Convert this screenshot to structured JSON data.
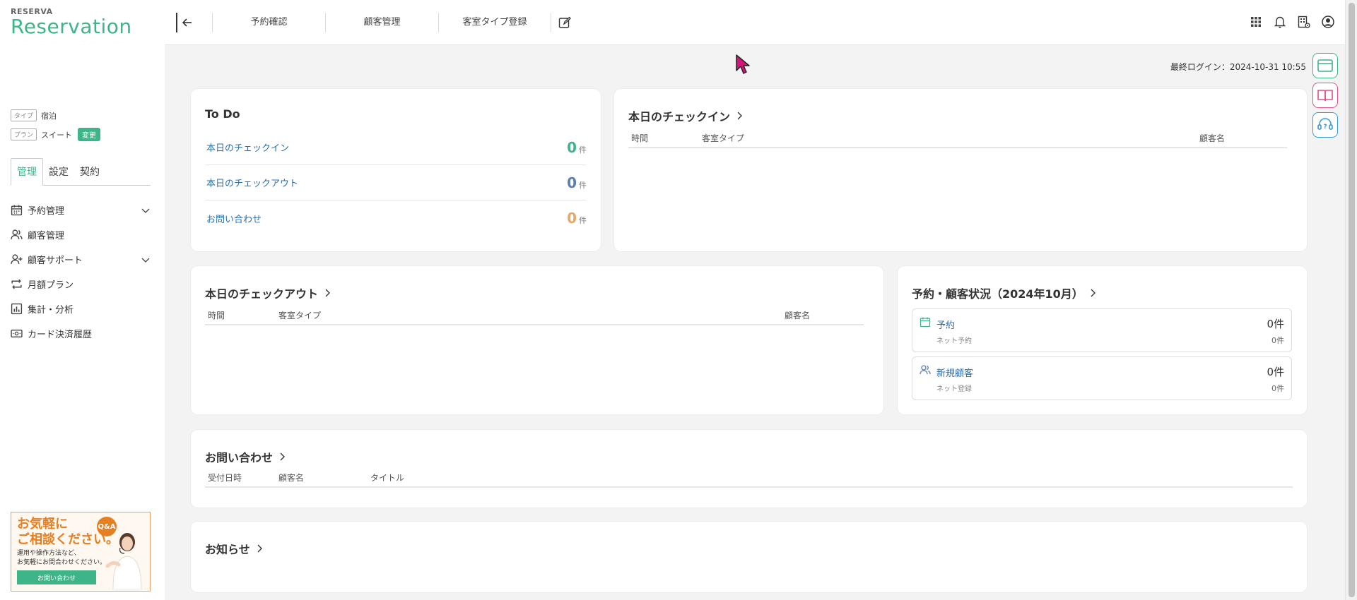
{
  "brand": {
    "small": "RESERVA",
    "big": "Reservation"
  },
  "account": {
    "type_tag": "タイプ",
    "type_value": "宿泊",
    "plan_tag": "プラン",
    "plan_value": "スイート",
    "plan_change": "変更"
  },
  "side_tabs": [
    "管理",
    "設定",
    "契約"
  ],
  "side_menu": [
    {
      "label": "予約管理",
      "icon": "calendar-icon",
      "expandable": true
    },
    {
      "label": "顧客管理",
      "icon": "users-icon",
      "expandable": false
    },
    {
      "label": "顧客サポート",
      "icon": "user-plus-icon",
      "expandable": true
    },
    {
      "label": "月額プラン",
      "icon": "repeat-icon",
      "expandable": false
    },
    {
      "label": "集計・分析",
      "icon": "bar-chart-icon",
      "expandable": false
    },
    {
      "label": "カード決済履歴",
      "icon": "card-icon",
      "expandable": false
    }
  ],
  "banner": {
    "title_line1": "お気軽に",
    "title_line2": "ご相談ください。",
    "qa": "Q&A",
    "desc_line1": "運用や操作方法など、",
    "desc_line2": "お気軽にお問合わせください。",
    "button": "お問い合わせ"
  },
  "topbar": {
    "nav": [
      "予約確認",
      "顧客管理",
      "客室タイプ登録"
    ],
    "right_icons": [
      "grid-icon",
      "bell-icon",
      "building-settings-icon",
      "user-circle-icon"
    ]
  },
  "last_login": "最終ログイン：2024-10-31 10:55",
  "todo": {
    "title": "To Do",
    "unit": "件",
    "rows": [
      {
        "label": "本日のチェックイン",
        "count": "0",
        "color": "#3eb489"
      },
      {
        "label": "本日のチェックアウト",
        "count": "0",
        "color": "#5b7fb5"
      },
      {
        "label": "お問い合わせ",
        "count": "0",
        "color": "#e9a86a"
      }
    ]
  },
  "checkin": {
    "title": "本日のチェックイン",
    "cols": [
      "時間",
      "客室タイプ",
      "顧客名"
    ]
  },
  "checkout": {
    "title": "本日のチェックアウト",
    "cols": [
      "時間",
      "客室タイプ",
      "顧客名"
    ]
  },
  "status": {
    "title": "予約・顧客状況（2024年10月）",
    "items": [
      {
        "label": "予約",
        "sub": "ネット予約",
        "value": "0件",
        "sub_value": "0件",
        "icon": "calendar-icon"
      },
      {
        "label": "新規顧客",
        "sub": "ネット登録",
        "value": "0件",
        "sub_value": "0件",
        "icon": "users-icon"
      }
    ]
  },
  "inquiry": {
    "title": "お問い合わせ",
    "cols": [
      "受付日時",
      "顧客名",
      "タイトル"
    ]
  },
  "news": {
    "title": "お知らせ"
  },
  "colors": {
    "accent": "#3eb489",
    "link": "#2a6fb0"
  }
}
